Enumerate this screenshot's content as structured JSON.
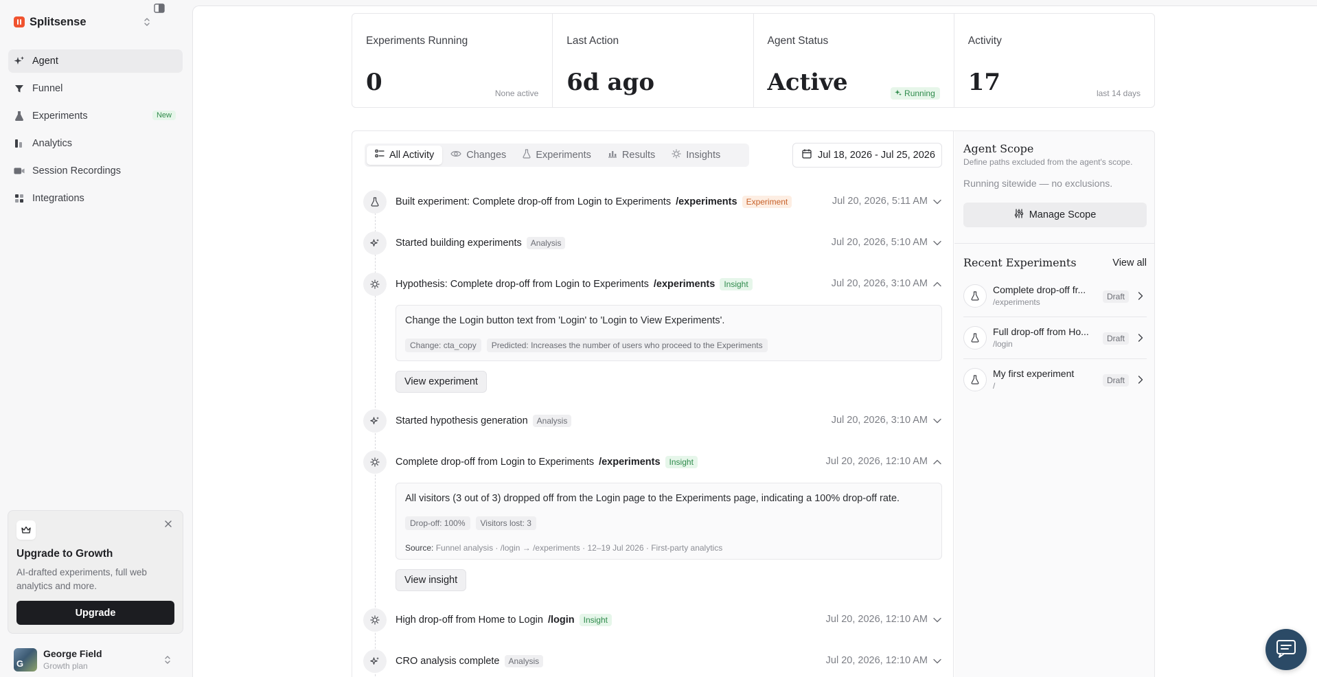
{
  "app": {
    "name": "Splitsense"
  },
  "nav": [
    {
      "label": "Agent",
      "icon": "sparkle-icon",
      "active": true
    },
    {
      "label": "Funnel",
      "icon": "funnel-icon"
    },
    {
      "label": "Experiments",
      "icon": "flask-icon",
      "badge": "New"
    },
    {
      "label": "Analytics",
      "icon": "bar-chart-icon"
    },
    {
      "label": "Session Recordings",
      "icon": "video-icon"
    },
    {
      "label": "Integrations",
      "icon": "grid-icon"
    }
  ],
  "upgrade": {
    "title": "Upgrade to Growth",
    "description": "AI-drafted experiments, full web analytics and more.",
    "button": "Upgrade"
  },
  "user": {
    "name": "George Field",
    "plan": "Growth plan",
    "initial": "G"
  },
  "stats": [
    {
      "label": "Experiments Running",
      "value": "0",
      "sub": "None active"
    },
    {
      "label": "Last Action",
      "value": "6d ago"
    },
    {
      "label": "Agent Status",
      "value": "Active",
      "badge": "Running"
    },
    {
      "label": "Activity",
      "value": "17",
      "sub": "last 14 days"
    }
  ],
  "tabs": [
    {
      "label": "All Activity",
      "active": true
    },
    {
      "label": "Changes"
    },
    {
      "label": "Experiments"
    },
    {
      "label": "Results"
    },
    {
      "label": "Insights"
    }
  ],
  "date_range": "Jul 18, 2026 - Jul 25, 2026",
  "feed": [
    {
      "title": "Built experiment: Complete drop-off from Login to Experiments",
      "path": "/experiments",
      "tag": "Experiment",
      "date": "Jul 20, 2026, 5:11 AM"
    },
    {
      "title": "Started building experiments",
      "tag": "Analysis",
      "date": "Jul 20, 2026, 5:10 AM"
    },
    {
      "title": "Hypothesis: Complete drop-off from Login to Experiments",
      "path": "/experiments",
      "tag": "Insight",
      "date": "Jul 20, 2026, 3:10 AM",
      "detail": "Change the Login button text from 'Login' to 'Login to View Experiments'.",
      "chips": [
        "Change: cta_copy",
        "Predicted: Increases the number of users who proceed to the Experiments"
      ],
      "action": "View experiment"
    },
    {
      "title": "Started hypothesis generation",
      "tag": "Analysis",
      "date": "Jul 20, 2026, 3:10 AM"
    },
    {
      "title": "Complete drop-off from Login to Experiments",
      "path": "/experiments",
      "tag": "Insight",
      "date": "Jul 20, 2026, 12:10 AM",
      "detail": "All visitors (3 out of 3) dropped off from the Login page to the Experiments page, indicating a 100% drop-off rate.",
      "chips": [
        "Drop-off: 100%",
        "Visitors lost: 3"
      ],
      "source_label": "Source:",
      "source": "Funnel analysis · /login → /experiments · 12–19 Jul 2026 · First-party analytics",
      "action": "View insight"
    },
    {
      "title": "High drop-off from Home to Login",
      "path": "/login",
      "tag": "Insight",
      "date": "Jul 20, 2026, 12:10 AM"
    },
    {
      "title": "CRO analysis complete",
      "tag": "Analysis",
      "date": "Jul 20, 2026, 12:10 AM"
    }
  ],
  "scope": {
    "title": "Agent Scope",
    "subtitle": "Define paths excluded from the agent's scope.",
    "status": "Running sitewide — no exclusions.",
    "button": "Manage Scope"
  },
  "recent": {
    "title": "Recent Experiments",
    "view_all": "View all",
    "items": [
      {
        "name": "Complete drop-off fr...",
        "path": "/experiments",
        "status": "Draft"
      },
      {
        "name": "Full drop-off from Ho...",
        "path": "/login",
        "status": "Draft"
      },
      {
        "name": "My first experiment",
        "path": "/",
        "status": "Draft"
      }
    ]
  },
  "colors": {
    "brand": "#f0532f",
    "primary_button": "#1c1d21",
    "chat": "#2b4a66"
  }
}
